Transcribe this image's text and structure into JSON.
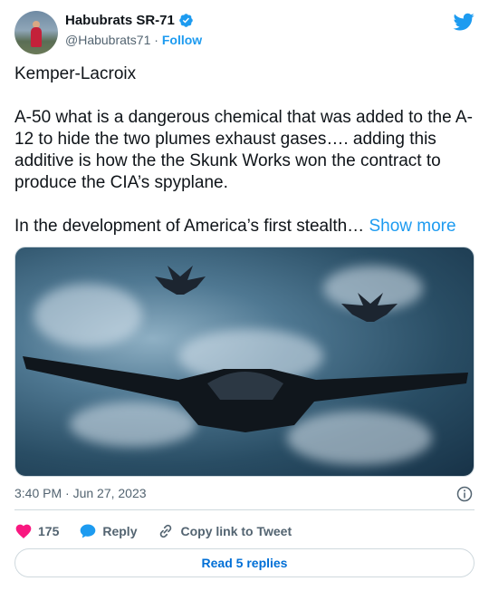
{
  "author": {
    "name": "Habubrats SR-71",
    "handle": "@Habubrats71",
    "separator": "·",
    "follow_label": "Follow"
  },
  "tweet": {
    "title_line": "Kemper-Lacroix",
    "paragraph_1": "A-50 what is a dangerous chemical that was added to the A-12 to hide the two plumes exhaust gases….   adding this additive is how the the Skunk Works won the contract to produce the CIA’s spyplane.",
    "paragraph_2": "In the development of America’s first stealth…",
    "show_more_label": "Show more"
  },
  "meta": {
    "timestamp": "3:40 PM · Jun 27, 2023"
  },
  "actions": {
    "like_count": "175",
    "reply_label": "Reply",
    "copy_link_label": "Copy link to Tweet"
  },
  "read_replies_label": "Read 5 replies",
  "icons": {
    "platform": "twitter-bird-icon",
    "verified": "verified-badge-icon",
    "info": "info-icon",
    "like": "heart-icon",
    "reply": "speech-bubble-icon",
    "copy": "link-icon"
  },
  "colors": {
    "accent": "#1d9bf0",
    "like": "#f91880",
    "muted": "#536471",
    "replies_link": "#006fd6"
  }
}
